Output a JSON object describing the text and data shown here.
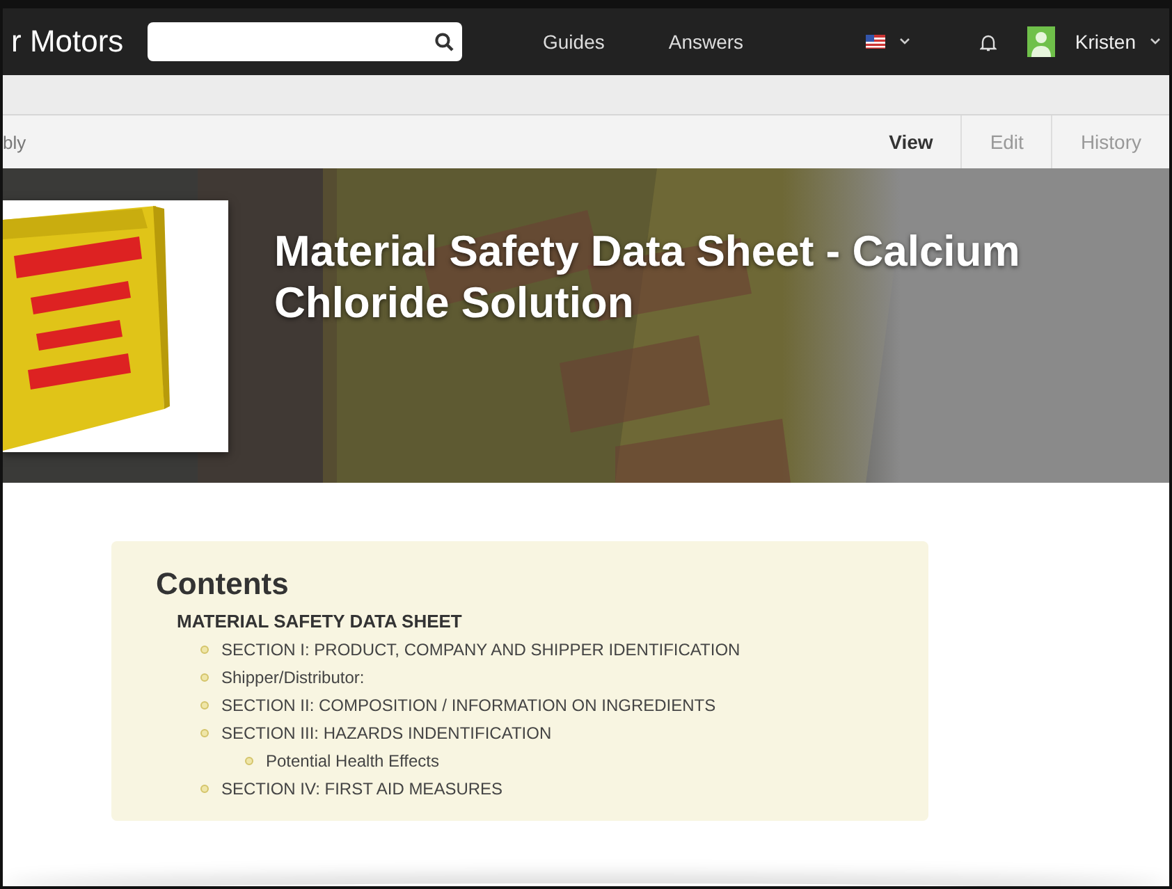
{
  "navbar": {
    "logo": "r Motors",
    "links": [
      "Guides",
      "Answers"
    ],
    "user": "Kristen"
  },
  "subnav": {
    "breadcrumb": "bly",
    "tabs": [
      {
        "label": "View",
        "selected": true
      },
      {
        "label": "Edit",
        "selected": false
      },
      {
        "label": "History",
        "selected": false
      }
    ]
  },
  "banner": {
    "title": "Material Safety Data Sheet - Calcium Chloride Solution"
  },
  "contents": {
    "heading": "Contents",
    "section": "MATERIAL SAFETY DATA SHEET",
    "items": [
      {
        "label": "SECTION I: PRODUCT, COMPANY AND SHIPPER IDENTIFICATION"
      },
      {
        "label": "Shipper/Distributor:"
      },
      {
        "label": "SECTION II: COMPOSITION / INFORMATION ON INGREDIENTS"
      },
      {
        "label": "SECTION III: HAZARDS INDENTIFICATION",
        "children": [
          {
            "label": "Potential Health Effects"
          }
        ]
      },
      {
        "label": "SECTION IV: FIRST AID MEASURES"
      }
    ]
  }
}
